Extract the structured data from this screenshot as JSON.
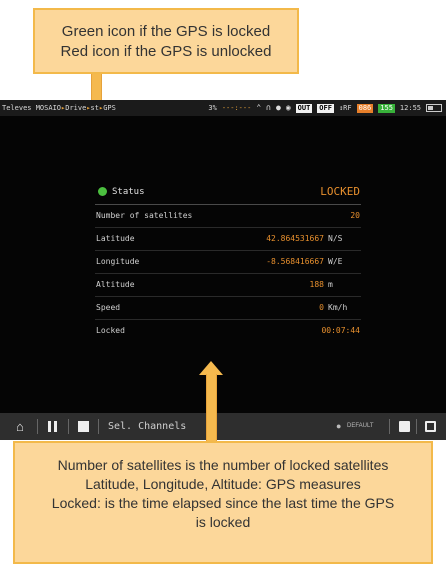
{
  "callout_top": {
    "line1": "Green icon if the GPS is locked",
    "line2": "Red icon if the GPS is unlocked"
  },
  "callout_bottom": {
    "line1": "Number of satellites is the number of locked satellites",
    "line2": "Latitude, Longitude, Altitude: GPS measures",
    "line3": "Locked: is the time elapsed since the last time the GPS",
    "line4": "is locked"
  },
  "status_bar": {
    "brand": "Televes MOSAIO",
    "path_part": "Drive",
    "path_tail": "st",
    "section": "GPS",
    "battery_pct": "3%",
    "dashes": "---:---",
    "out_label": "OUT",
    "off_label": "OFF",
    "rf_label": "↕RF",
    "signal_a": "086",
    "signal_b": "155",
    "time": "12:55",
    "icons": [
      "antenna-icon",
      "headphones-icon",
      "location-pin-icon",
      "wifi-icon",
      "battery-icon"
    ]
  },
  "gps": {
    "status_label": "Status",
    "status_value": "LOCKED",
    "status_color": "#4bbf3f",
    "rows": [
      {
        "label": "Number of satellites",
        "value": "20",
        "unit": ""
      },
      {
        "label": "Latitude",
        "value": "42.864531667",
        "unit": "N/S"
      },
      {
        "label": "Longitude",
        "value": "-8.568416667",
        "unit": "W/E"
      },
      {
        "label": "Altitude",
        "value": "188",
        "unit": "m"
      },
      {
        "label": "Speed",
        "value": "0",
        "unit": "Km/h"
      },
      {
        "label": "Locked",
        "value": "00:07:44",
        "unit": ""
      }
    ]
  },
  "toolbar": {
    "sel_channels": "Sel. Channels",
    "default_label": "DEFAULT",
    "icons": [
      "home-icon",
      "pause-icon",
      "stop-icon",
      "user-icon",
      "save-icon",
      "open-icon"
    ]
  },
  "colors": {
    "accent": "#e8902e",
    "callout_fill": "#fcd79a",
    "callout_border": "#f3b94a"
  }
}
